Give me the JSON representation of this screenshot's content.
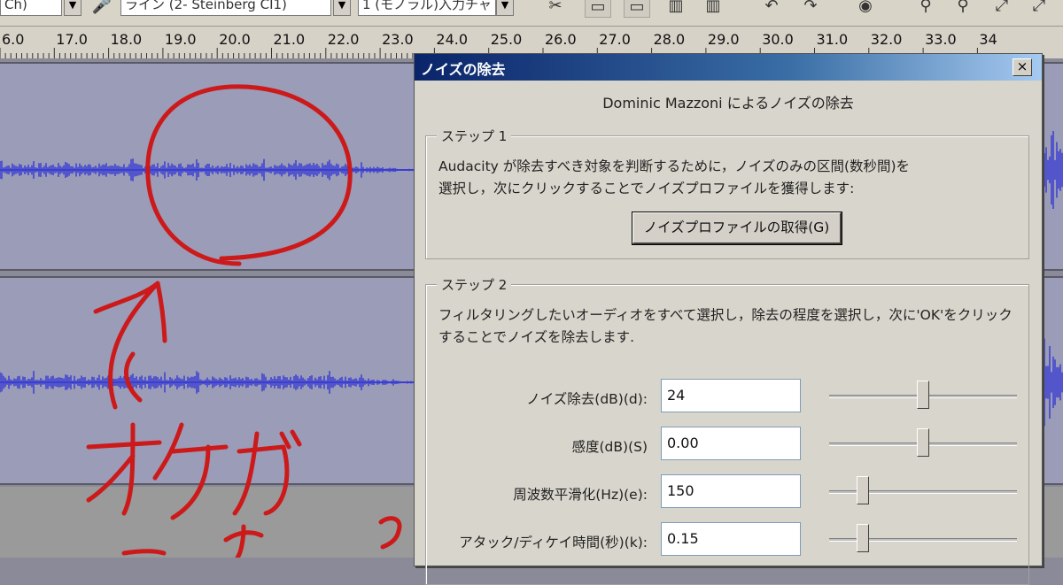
{
  "toolbar": {
    "combo1": "Ch)",
    "combo2": "ライン (2- Steinberg CI1)",
    "combo3": "1 (モノラル)入力チャ"
  },
  "ruler": {
    "ticks": [
      "6.0",
      "17.0",
      "18.0",
      "19.0",
      "20.0",
      "21.0",
      "22.0",
      "23.0",
      "24.0",
      "25.0",
      "26.0",
      "27.0",
      "28.0",
      "29.0",
      "30.0",
      "31.0",
      "32.0",
      "33.0",
      "34"
    ]
  },
  "annotation": {
    "handwriting": "オケが ココまで残る"
  },
  "dialog": {
    "title": "ノイズの除去",
    "close_label": "×",
    "byline": "Dominic Mazzoni によるノイズの除去",
    "step1": {
      "title": "ステップ 1",
      "line1": "Audacity が除去すべき対象を判断するために，ノイズのみの区間(数秒間)を",
      "line2": "選択し，次にクリックすることでノイズプロファイルを獲得します:",
      "button": "ノイズプロファイルの取得(G)"
    },
    "step2": {
      "title": "ステップ 2",
      "line1": "フィルタリングしたいオーディオをすべて選択し，除去の程度を選択し，次に'OK'をクリック",
      "line2": "することでノイズを除去します.",
      "rows": [
        {
          "label": "ノイズ除去(dB)(d):",
          "value": "24",
          "slider": 0.5
        },
        {
          "label": "感度(dB)(S)",
          "value": "0.00",
          "slider": 0.5
        },
        {
          "label": "周波数平滑化(Hz)(e):",
          "value": "150",
          "slider": 0.18
        },
        {
          "label": "アタック/ディケイ時間(秒)(k):",
          "value": "0.15",
          "slider": 0.18
        }
      ]
    }
  },
  "colors": {
    "waveform": "#3b3fd0",
    "annotation": "#cc1a1a",
    "titlebar": "#0a246a"
  }
}
